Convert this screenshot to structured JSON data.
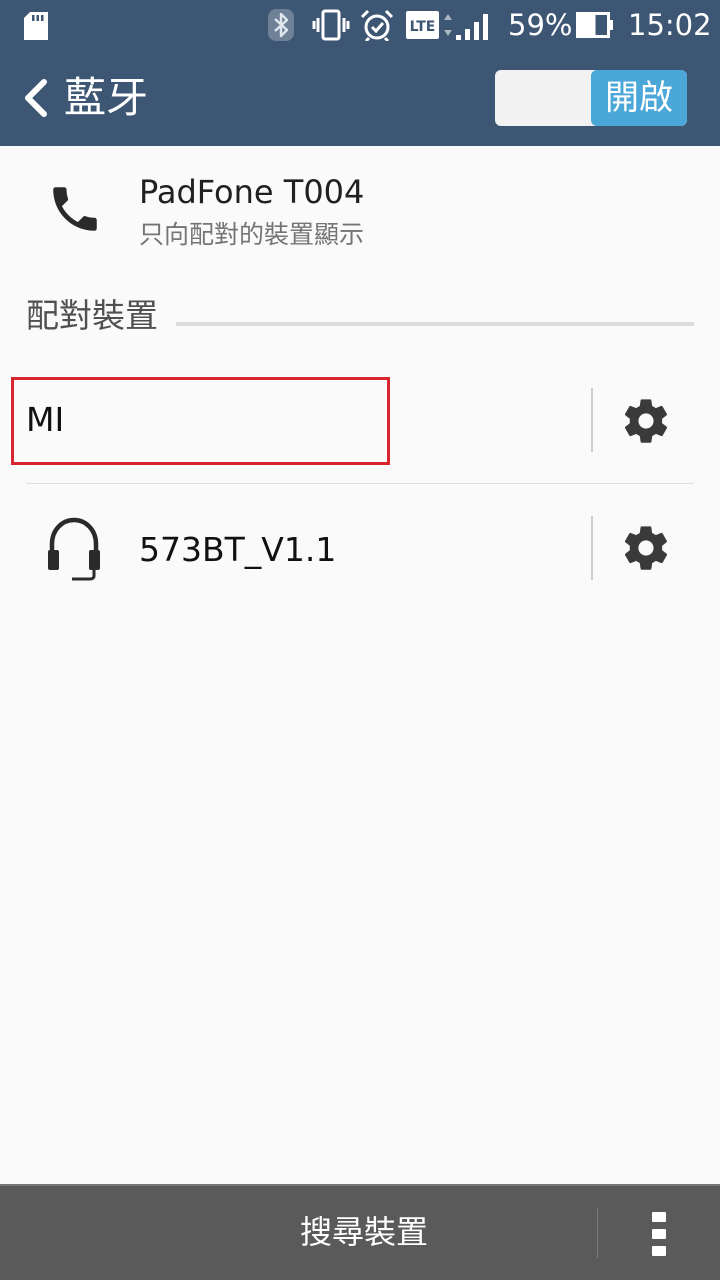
{
  "status_bar": {
    "icons": [
      "sd-card-icon",
      "bluetooth-icon",
      "vibrate-icon",
      "alarm-icon",
      "lte-icon",
      "signal-icon",
      "battery-icon"
    ],
    "lte_text": "LTE",
    "battery_percent": "59%",
    "battery_level": 0.59,
    "time": "15:02"
  },
  "app_bar": {
    "title": "藍牙",
    "toggle_label": "開啟",
    "toggle_on": true
  },
  "this_device": {
    "name": "PadFone T004",
    "subtitle": "只向配對的裝置顯示",
    "icon": "phone-icon"
  },
  "paired_devices": {
    "header": "配對裝置",
    "items": [
      {
        "name": "MI",
        "icon": "",
        "highlighted": true,
        "settings_icon": "gear-icon"
      },
      {
        "name": "573BT_V1.1",
        "icon": "headset-icon",
        "highlighted": false,
        "settings_icon": "gear-icon"
      }
    ]
  },
  "bottom_bar": {
    "scan_label": "搜尋裝置",
    "more_icon": "more-vert-icon"
  },
  "colors": {
    "header_bg": "#3d5673",
    "toggle_on": "#4aa7d8",
    "highlight_border": "#d9252f",
    "bottom_bar_bg": "#5a5a5a"
  }
}
